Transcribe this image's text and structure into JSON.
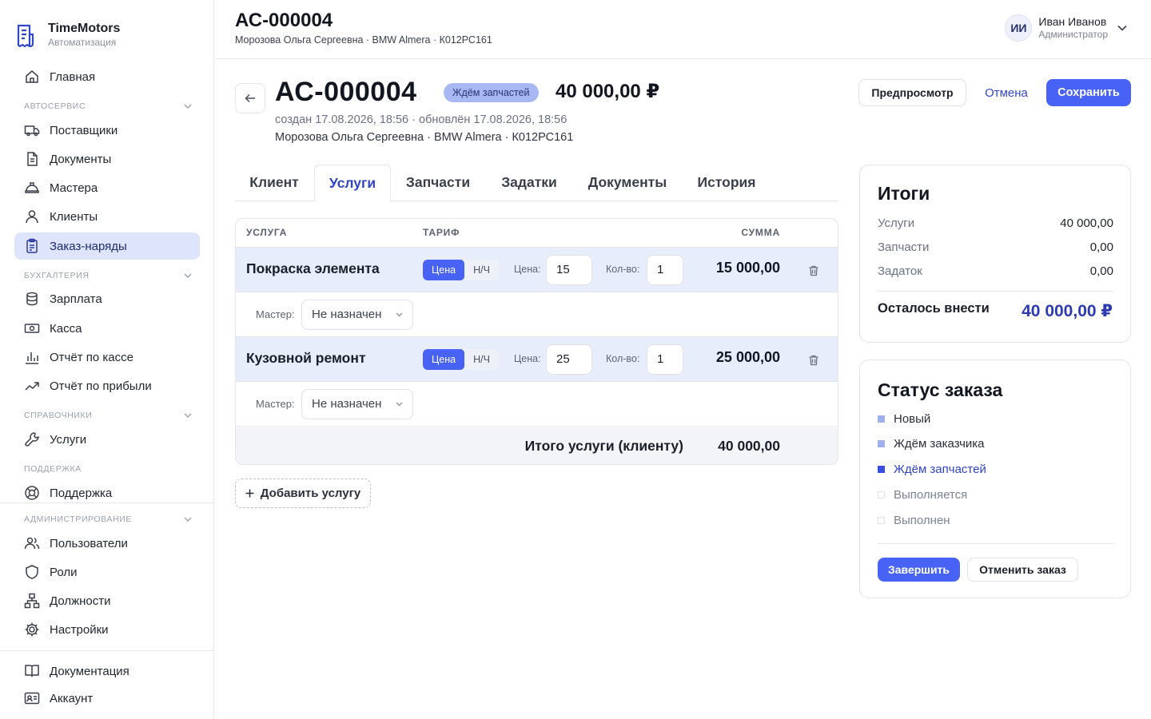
{
  "brand": {
    "name": "TimeMotors",
    "subtitle": "Автоматизация",
    "logo_icon": "receipt-logo-icon"
  },
  "sidebar": {
    "home": "Главная",
    "sections": {
      "autoservice": "АВТОСЕРВИС",
      "accounting": "БУХГАЛТЕРИЯ",
      "references": "СПРАВОЧНИКИ",
      "support": "ПОДДЕРЖКА",
      "admin": "АДМИНИСТРИРОВАНИЕ"
    },
    "items": {
      "suppliers": "Поставщики",
      "documents": "Документы",
      "masters": "Мастера",
      "clients": "Клиенты",
      "orders": "Заказ-наряды",
      "salary": "Зарплата",
      "cash": "Касса",
      "cash_report": "Отчёт по кассе",
      "profit_report": "Отчёт по прибыли",
      "services": "Услуги",
      "support": "Поддержка",
      "users": "Пользователи",
      "roles": "Роли",
      "positions": "Должности",
      "settings": "Настройки",
      "docs": "Документация",
      "account": "Аккаунт"
    },
    "active": "orders"
  },
  "topbar": {
    "title": "АС-000004",
    "subtitle": "Морозова Ольга Сергеевна · BMW Almera · К012РС161",
    "user": {
      "initials": "ИИ",
      "name": "Иван Иванов",
      "role": "Администратор"
    }
  },
  "order": {
    "id": "АС-000004",
    "status_badge": "Ждём запчастей",
    "total": "40 000,00 ₽",
    "meta_dates": "создан 17.08.2026, 18:56 · обновлён 17.08.2026, 18:56",
    "meta_client": "Морозова Ольга Сергеевна · BMW Almera · К012РС161"
  },
  "actions": {
    "preview": "Предпросмотр",
    "cancel": "Отмена",
    "save": "Сохранить"
  },
  "tabs": [
    "Клиент",
    "Услуги",
    "Запчасти",
    "Задатки",
    "Документы",
    "История"
  ],
  "active_tab": "Услуги",
  "services_table": {
    "headers": {
      "service": "УСЛУГА",
      "tariff": "ТАРИФ",
      "sum": "СУММА"
    },
    "tariff_options": [
      "Цена",
      "Н/Ч"
    ],
    "price_label": "Цена:",
    "qty_label": "Кол-во:",
    "master_label": "Мастер:",
    "rows": [
      {
        "name": "Покраска элемента",
        "tariff": "Цена",
        "price": "15",
        "qty": "1",
        "sum": "15 000,00",
        "master": "Не назначен"
      },
      {
        "name": "Кузовной ремонт",
        "tariff": "Цена",
        "price": "25",
        "qty": "1",
        "sum": "25 000,00",
        "master": "Не назначен"
      }
    ],
    "footer_label": "Итого услуги (клиенту)",
    "footer_value": "40 000,00"
  },
  "add_service": "Добавить услугу",
  "totals": {
    "title": "Итоги",
    "services_label": "Услуги",
    "services_value": "40 000,00",
    "parts_label": "Запчасти",
    "parts_value": "0,00",
    "deposit_label": "Задаток",
    "deposit_value": "0,00",
    "remaining_label": "Осталось внести",
    "remaining_value": "40 000,00 ₽"
  },
  "order_status": {
    "title": "Статус заказа",
    "steps": [
      {
        "label": "Новый",
        "state": "done"
      },
      {
        "label": "Ждём заказчика",
        "state": "done"
      },
      {
        "label": "Ждём запчастей",
        "state": "current"
      },
      {
        "label": "Выполняется",
        "state": "todo"
      },
      {
        "label": "Выполнен",
        "state": "todo"
      }
    ],
    "finish": "Завершить",
    "cancel_order": "Отменить заказ"
  },
  "colors": {
    "accent": "#4862f5",
    "active_nav_bg": "#dde4fb",
    "badge_bg": "#a7b8f3",
    "row_highlight": "#e7edfb"
  }
}
